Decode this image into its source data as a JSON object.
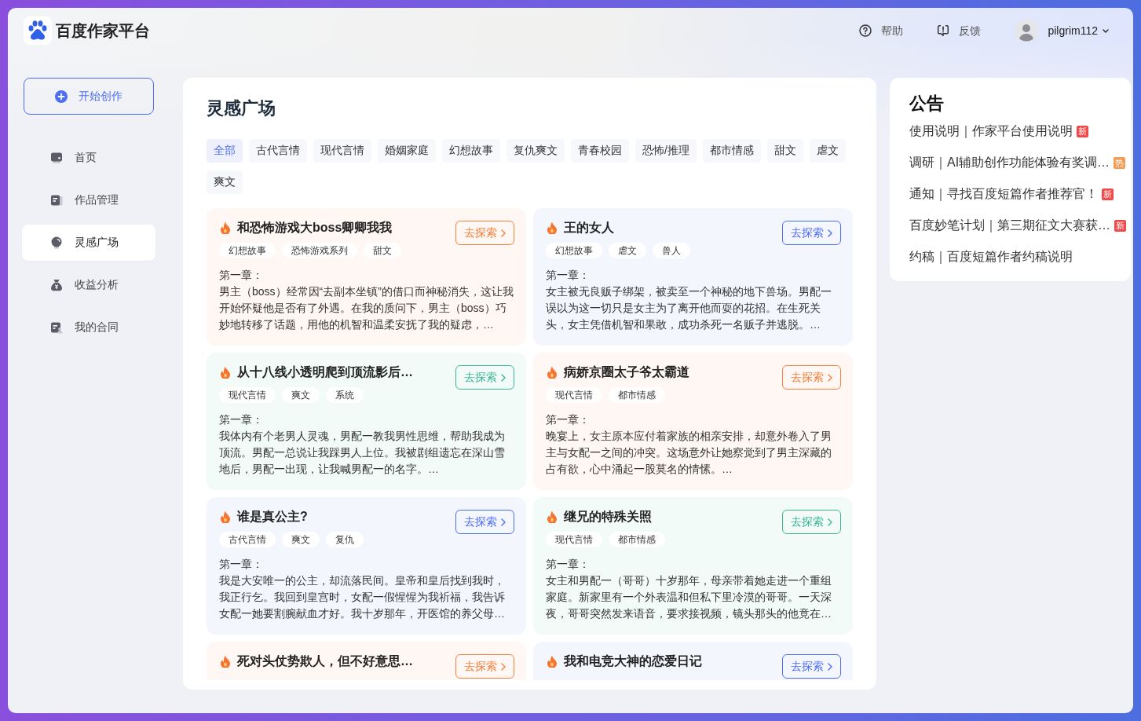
{
  "header": {
    "title": "百度作家平台",
    "links": [
      {
        "kind": "help",
        "label": "帮助"
      },
      {
        "kind": "feedback",
        "label": "反馈"
      }
    ],
    "user": {
      "name": "pilgrim112"
    }
  },
  "sidebar": {
    "create_button": "开始创作",
    "items": [
      {
        "kind": "home",
        "label": "首页",
        "selected": false
      },
      {
        "kind": "works",
        "label": "作品管理",
        "selected": false
      },
      {
        "kind": "inspiration",
        "label": "灵感广场",
        "selected": true
      },
      {
        "kind": "earnings",
        "label": "收益分析",
        "selected": false
      },
      {
        "kind": "contract",
        "label": "我的合同",
        "selected": false
      }
    ]
  },
  "main": {
    "title": "灵感广场",
    "filters": [
      {
        "label": "全部",
        "selected": true
      },
      {
        "label": "古代言情",
        "selected": false
      },
      {
        "label": "现代言情",
        "selected": false
      },
      {
        "label": "婚姻家庭",
        "selected": false
      },
      {
        "label": "幻想故事",
        "selected": false
      },
      {
        "label": "复仇爽文",
        "selected": false
      },
      {
        "label": "青春校园",
        "selected": false
      },
      {
        "label": "恐怖/推理",
        "selected": false
      },
      {
        "label": "都市情感",
        "selected": false
      },
      {
        "label": "甜文",
        "selected": false
      },
      {
        "label": "虐文",
        "selected": false
      },
      {
        "label": "爽文",
        "selected": false
      }
    ],
    "cards": [
      {
        "title": "和恐怖游戏大boss卿卿我我",
        "color": "#f5803e",
        "button": "去探索",
        "tags": [
          "幻想故事",
          "恐怖游戏系列",
          "甜文"
        ],
        "chapter": "第一章：",
        "excerpt": "男主（boss）经常因“去副本坐镇”的借口而神秘消失，这让我开始怀疑他是否有了外遇。在我的质问下，男主（boss）巧妙地转移了话题，用他的机智和温柔安抚了我的疑虑，…"
      },
      {
        "title": "王的女人",
        "color": "#4e6ef2",
        "button": "去探索",
        "tags": [
          "幻想故事",
          "虐文",
          "兽人"
        ],
        "chapter": "第一章：",
        "excerpt": "女主被无良贩子绑架，被卖至一个神秘的地下兽场。男配一误以为这一切只是女主为了离开他而耍的花招。在生死关头，女主凭借机智和果敢，成功杀死一名贩子并逃脱。…"
      },
      {
        "title": "从十八线小透明爬到顶流影后…",
        "color": "#3cb595",
        "button": "去探索",
        "tags": [
          "现代言情",
          "爽文",
          "系统"
        ],
        "chapter": "第一章：",
        "excerpt": "我体内有个老男人灵魂，男配一教我男性思维，帮助我成为顶流。男配一总说让我踩男人上位。我被剧组遗忘在深山雪地后，男配一出现，让我喊男配一的名字。…"
      },
      {
        "title": "病娇京圈太子爷太霸道",
        "color": "#f5803e",
        "button": "去探索",
        "tags": [
          "现代言情",
          "都市情感"
        ],
        "chapter": "第一章：",
        "excerpt": "晚宴上，女主原本应付着家族的相亲安排，却意外卷入了男主与女配一之间的冲突。这场意外让她察觉到了男主深藏的占有欲，心中涌起一股莫名的情愫。…"
      },
      {
        "title": "谁是真公主?",
        "color": "#4e6ef2",
        "button": "去探索",
        "tags": [
          "古代言情",
          "爽文",
          "复仇"
        ],
        "chapter": "第一章：",
        "excerpt": "我是大安唯一的公主，却流落民间。皇帝和皇后找到我时，我正行乞。我回到皇宫时，女配一假惺惺为我祈福，我告诉女配一她要割腕献血才好。我十岁那年，开医馆的养父母…"
      },
      {
        "title": "继兄的特殊关照",
        "color": "#3cb595",
        "button": "去探索",
        "tags": [
          "现代言情",
          "都市情感"
        ],
        "chapter": "第一章：",
        "excerpt": "女主和男配一（哥哥）十岁那年，母亲带着她走进一个重组家庭。新家里有一个外表温和但私下里冷漠的哥哥。一天深夜，哥哥突然发来语音，要求接视频，镜头那头的他竟在…"
      },
      {
        "title": "死对头仗势欺人，但不好意思…",
        "color": "#f5803e",
        "button": "去探索"
      },
      {
        "title": "我和电竞大神的恋爱日记",
        "color": "#4e6ef2",
        "button": "去探索"
      }
    ]
  },
  "notices": {
    "title": "公告",
    "items": [
      {
        "text": "使用说明｜作家平台使用说明",
        "badge": {
          "label": "新",
          "color": "#f04848"
        }
      },
      {
        "text": "调研｜AI辅助创作功能体验有奖调…",
        "badge": {
          "label": "热",
          "color": "#f59b52"
        }
      },
      {
        "text": "通知｜寻找百度短篇作者推荐官！",
        "badge": {
          "label": "新",
          "color": "#f04848"
        }
      },
      {
        "text": "百度妙笔计划｜第三期征文大赛获…",
        "badge": {
          "label": "新",
          "color": "#f04848"
        }
      },
      {
        "text": "约稿｜百度短篇作者约稿说明"
      }
    ]
  }
}
